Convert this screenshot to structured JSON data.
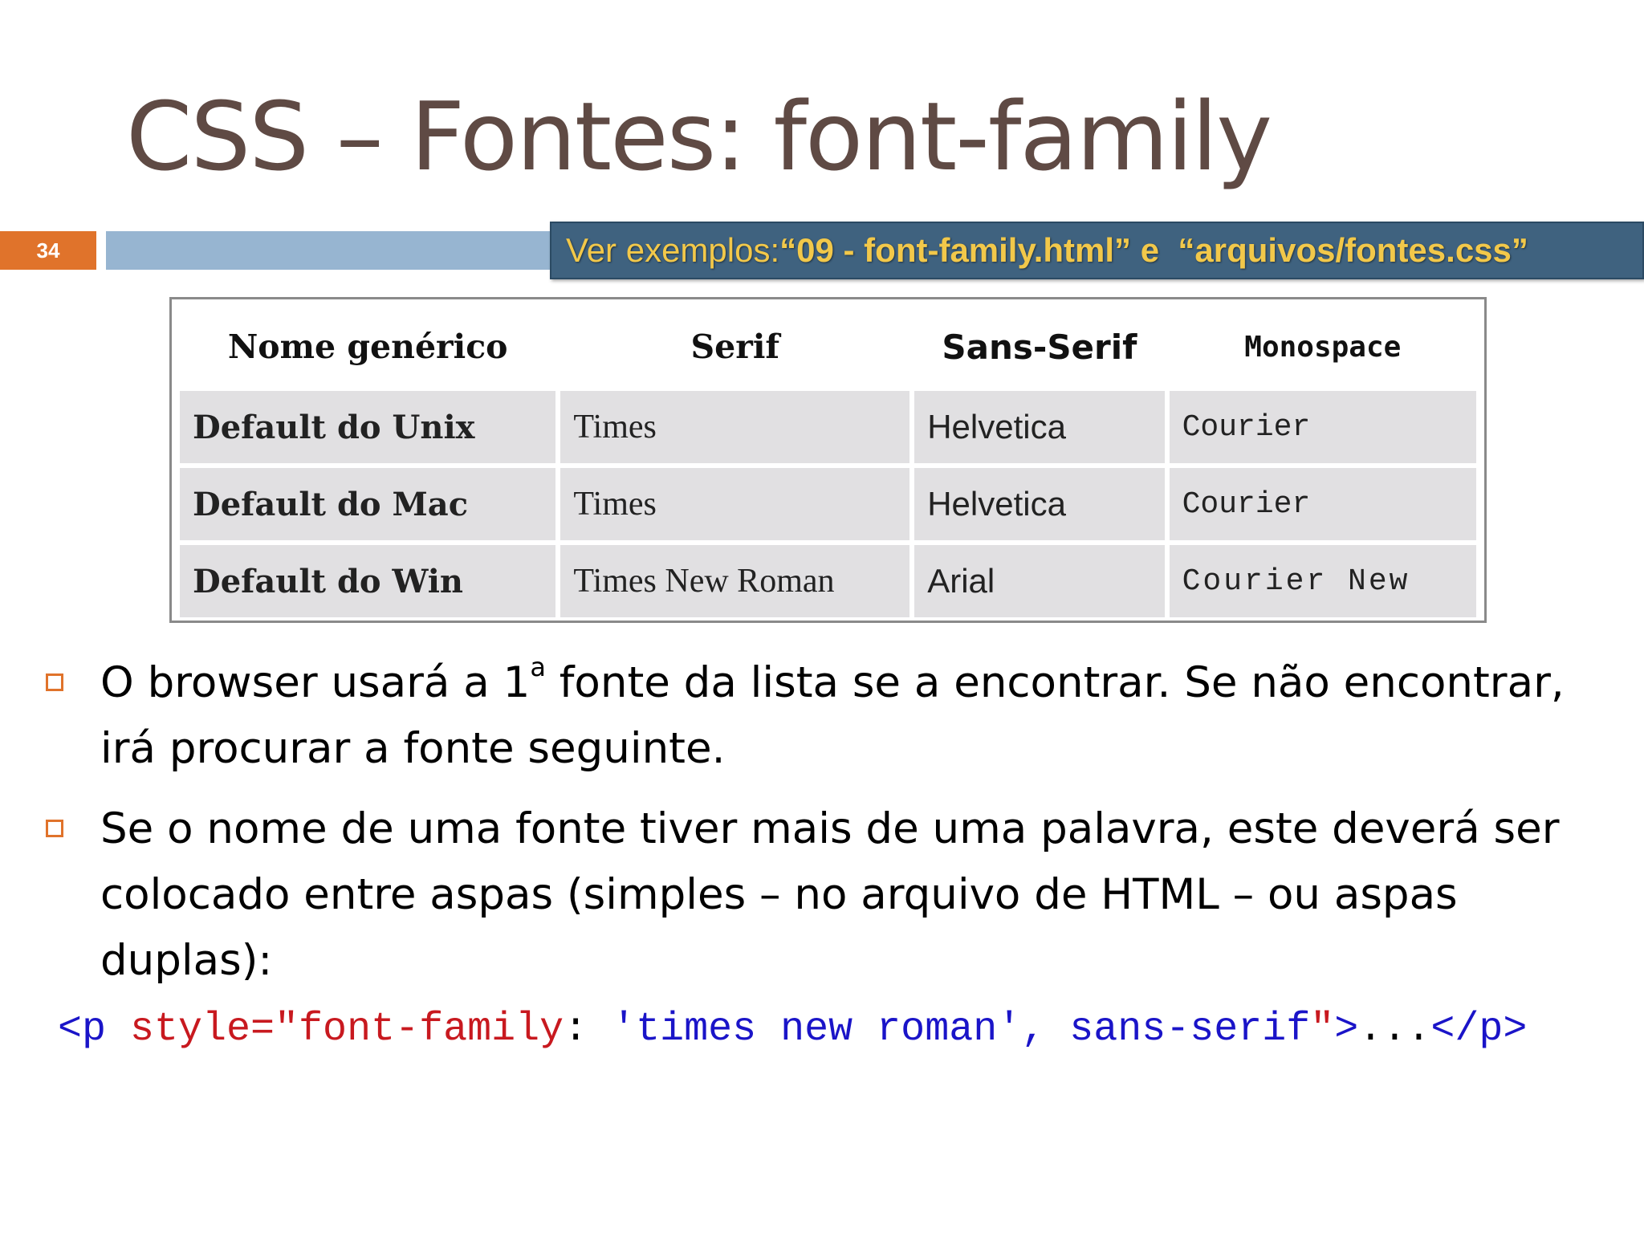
{
  "slide": {
    "title": "CSS – Fontes: font-family",
    "number": "34",
    "reference": {
      "prefix": "Ver exemplos: ",
      "file1": "“09 - font-family.html”",
      "conj": " e  ",
      "file2": "“arquivos/fontes.css”"
    },
    "colors": {
      "title": "#5f4a44",
      "number_bg": "#e0732b",
      "bar": "#97b5d1",
      "ref_box": "#3f627f",
      "ref_text": "#f2c84a"
    }
  },
  "table": {
    "headers": [
      "Nome genérico",
      "Serif",
      "Sans-Serif",
      "Monospace"
    ],
    "rows": [
      [
        "Default do Unix",
        "Times",
        "Helvetica",
        "Courier"
      ],
      [
        "Default do Mac",
        "Times",
        "Helvetica",
        "Courier"
      ],
      [
        "Default do Win",
        "Times New Roman",
        "Arial",
        "Courier New"
      ]
    ]
  },
  "bullets": [
    {
      "before_sup": "O browser usará a 1",
      "sup": "a",
      "after_sup": " fonte da lista se a encontrar. Se não encontrar, irá procurar a fonte seguinte."
    },
    {
      "text": "Se o nome de uma fonte tiver mais de uma palavra, este deverá ser colocado entre aspas (simples – no arquivo de HTML – ou aspas duplas):"
    }
  ],
  "code": {
    "tag_open": "<p",
    "attr": " style=\"font-family",
    "colon": ": ",
    "value": "'times new roman', sans-serif",
    "quote_close": "\"",
    "tag_close": ">",
    "ellipsis": "...",
    "end_tag": "</p>"
  }
}
